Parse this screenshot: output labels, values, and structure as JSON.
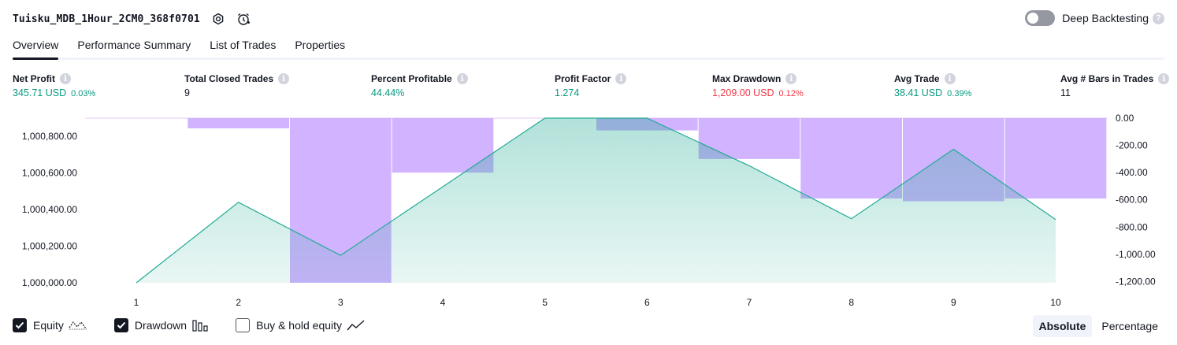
{
  "header": {
    "strategy_name": "Tuisku_MDB_1Hour_2CM0_368f0701",
    "settings_icon": "gear-icon",
    "alert_icon": "alarm-clock-icon",
    "deep_backtesting_label": "Deep Backtesting",
    "deep_backtesting_enabled": false,
    "help_label": "?"
  },
  "tabs": [
    {
      "label": "Overview",
      "active": true
    },
    {
      "label": "Performance Summary",
      "active": false
    },
    {
      "label": "List of Trades",
      "active": false
    },
    {
      "label": "Properties",
      "active": false
    }
  ],
  "metrics": [
    {
      "label": "Net Profit",
      "value": "345.71 USD",
      "pct": "0.03%",
      "color": "green"
    },
    {
      "label": "Total Closed Trades",
      "value": "9",
      "pct": "",
      "color": "dark"
    },
    {
      "label": "Percent Profitable",
      "value": "44.44%",
      "pct": "",
      "color": "green"
    },
    {
      "label": "Profit Factor",
      "value": "1.274",
      "pct": "",
      "color": "green"
    },
    {
      "label": "Max Drawdown",
      "value": "1,209.00 USD",
      "pct": "0.12%",
      "color": "red"
    },
    {
      "label": "Avg Trade",
      "value": "38.41 USD",
      "pct": "0.39%",
      "color": "green"
    },
    {
      "label": "Avg # Bars in Trades",
      "value": "11",
      "pct": "",
      "color": "dark"
    }
  ],
  "info_glyph": "i",
  "colors": {
    "equity_line": "#22ab94",
    "equity_fill": "#22ab94",
    "drawdown_bar": "#c9a6ff",
    "overlap": "#9c9ee0",
    "green": "#089981",
    "red": "#f23645"
  },
  "chart_data": {
    "type": "area",
    "x": [
      1,
      2,
      3,
      4,
      5,
      6,
      7,
      8,
      9,
      10
    ],
    "series": [
      {
        "name": "Equity",
        "type": "area",
        "axis": "left",
        "values": [
          1000000,
          1000440,
          1000150,
          1000525,
          1000900,
          1000900,
          1000640,
          1000350,
          1000730,
          1000345.71
        ]
      },
      {
        "name": "Drawdown",
        "type": "bar",
        "axis": "right",
        "values": [
          0,
          -75,
          -1209,
          -400,
          0,
          -90,
          -300,
          -590,
          -610,
          -590
        ]
      }
    ],
    "left_axis": {
      "ylim": [
        1000000,
        1000900
      ],
      "ticks": [
        "1,000,800.00",
        "1,000,600.00",
        "1,000,400.00",
        "1,000,200.00",
        "1,000,000.00"
      ],
      "tick_values": [
        1000800,
        1000600,
        1000400,
        1000200,
        1000000
      ]
    },
    "right_axis": {
      "ylim": [
        -1209,
        0
      ],
      "ticks": [
        "0.00",
        "-200.00",
        "-400.00",
        "-600.00",
        "-800.00",
        "-1,000.00",
        "-1,200.00"
      ],
      "tick_values": [
        0,
        -200,
        -400,
        -600,
        -800,
        -1000,
        -1200
      ]
    },
    "x_ticks": [
      "1",
      "2",
      "3",
      "4",
      "5",
      "6",
      "7",
      "8",
      "9",
      "10"
    ],
    "grid": false
  },
  "legend": [
    {
      "label": "Equity",
      "checked": true,
      "icon": "equity-line-icon"
    },
    {
      "label": "Drawdown",
      "checked": true,
      "icon": "drawdown-bars-icon"
    },
    {
      "label": "Buy & hold equity",
      "checked": false,
      "icon": "buy-hold-line-icon"
    }
  ],
  "modes": [
    {
      "label": "Absolute",
      "active": true
    },
    {
      "label": "Percentage",
      "active": false
    }
  ]
}
